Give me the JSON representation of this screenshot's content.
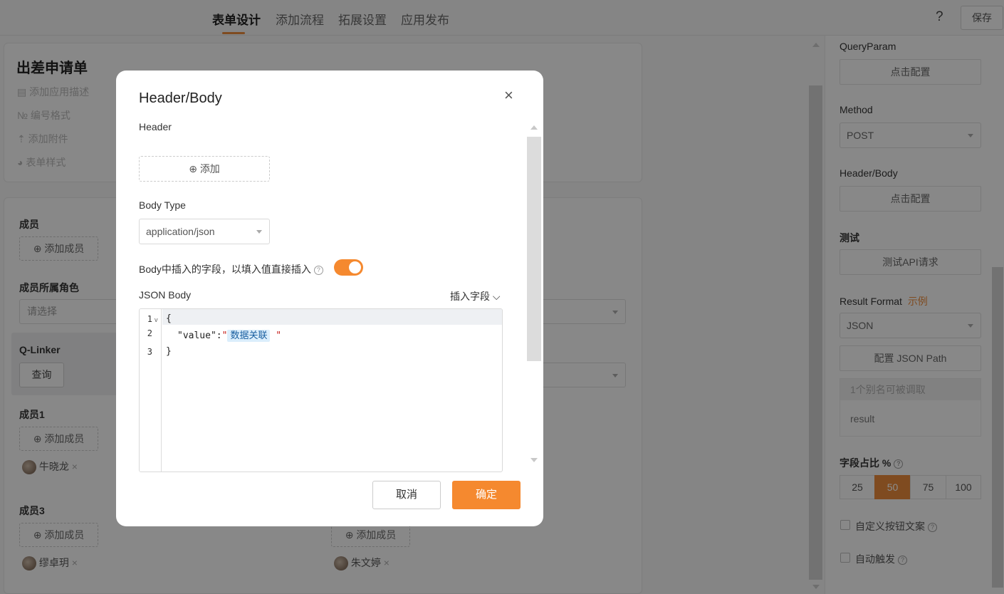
{
  "topbar": {
    "tabs": [
      {
        "label": "表单设计"
      },
      {
        "label": "添加流程"
      },
      {
        "label": "拓展设置"
      },
      {
        "label": "应用发布"
      }
    ],
    "help": "?",
    "save": "保存"
  },
  "form": {
    "title": "出差申请单",
    "menu": [
      "添加应用描述",
      "编号格式",
      "添加附件",
      "表单样式"
    ]
  },
  "canvas": {
    "members_label": "成员",
    "add_member": "添加成员",
    "role_label": "成员所属角色",
    "role_placeholder": "请选择",
    "qlinker_label": "Q-Linker",
    "query_btn": "查询",
    "member1_label": "成员1",
    "member1_user": "牛晓龙",
    "member3_label": "成员3",
    "member3_user": "缪卓玥",
    "right_user": "朱文婷",
    "remove": "×"
  },
  "right_panel": {
    "queryparam_label": "QueryParam",
    "configure": "点击配置",
    "method_label": "Method",
    "method_value": "POST",
    "headerbody_label": "Header/Body",
    "test_label": "测试",
    "test_btn": "测试API请求",
    "result_format_label": "Result Format",
    "example_link": "示例",
    "result_format_value": "JSON",
    "json_path_btn": "配置 JSON Path",
    "alias_header": "1个别名可被调取",
    "alias_value": "result",
    "ratio_label": "字段占比 %",
    "ratio_options": [
      "25",
      "50",
      "75",
      "100"
    ],
    "ratio_selected": "50",
    "custom_btn_text": "自定义按钮文案",
    "auto_trigger": "自动触发",
    "accent": "#e8893b"
  },
  "modal": {
    "title": "Header/Body",
    "close": "×",
    "header_label": "Header",
    "add_btn": "添加",
    "body_type_label": "Body Type",
    "body_type_value": "application/json",
    "insert_toggle_label": "Body中插入的字段，以填入值直接插入",
    "insert_toggle_on": true,
    "json_body_label": "JSON Body",
    "insert_field": "插入字段",
    "editor": {
      "line_numbers": [
        "1",
        "2",
        "3"
      ],
      "line1": "{",
      "line2_key": "\"value\":",
      "line2_quote_open": "\"",
      "line2_tag": "数据关联",
      "line2_quote_close": "\"",
      "line3": "}"
    },
    "cancel": "取消",
    "confirm": "确定",
    "toggle_color": "#f5892f"
  }
}
